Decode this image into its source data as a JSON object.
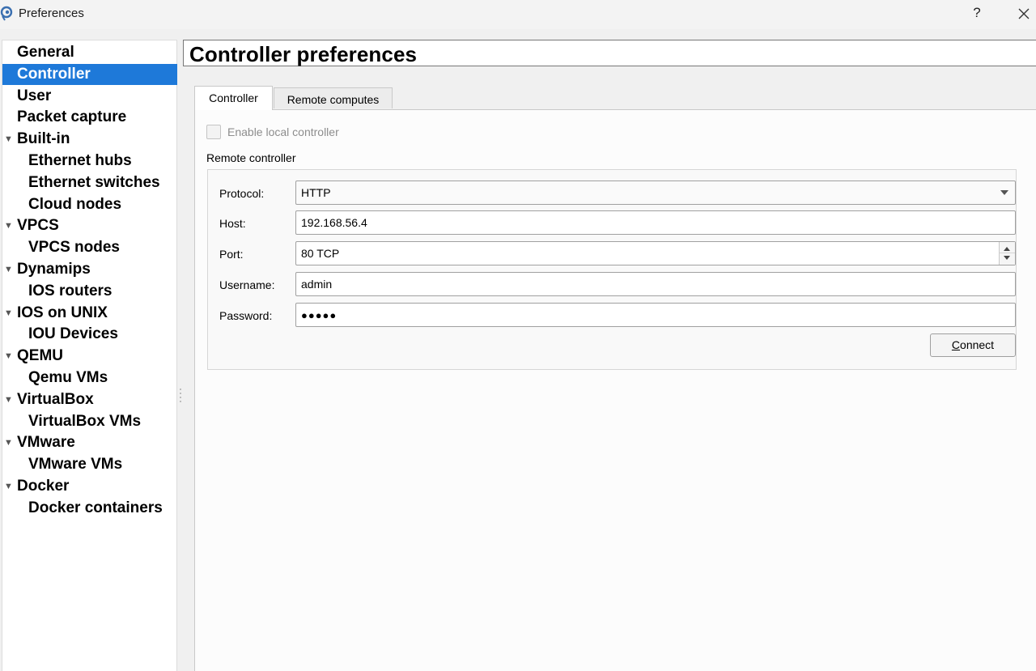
{
  "window": {
    "title": "Preferences",
    "help_label": "?",
    "icons": {
      "app": "gns3-app-icon",
      "close": "close-icon"
    }
  },
  "sidebar": {
    "selected_color": "#1e79d9",
    "items": [
      {
        "label": "General",
        "level": 0,
        "expandable": false,
        "selected": false
      },
      {
        "label": "Controller",
        "level": 0,
        "expandable": false,
        "selected": true
      },
      {
        "label": "User",
        "level": 0,
        "expandable": false,
        "selected": false
      },
      {
        "label": "Packet capture",
        "level": 0,
        "expandable": false,
        "selected": false
      },
      {
        "label": "Built-in",
        "level": 0,
        "expandable": true,
        "selected": false
      },
      {
        "label": "Ethernet hubs",
        "level": 1,
        "expandable": false,
        "selected": false
      },
      {
        "label": "Ethernet switches",
        "level": 1,
        "expandable": false,
        "selected": false
      },
      {
        "label": "Cloud nodes",
        "level": 1,
        "expandable": false,
        "selected": false
      },
      {
        "label": "VPCS",
        "level": 0,
        "expandable": true,
        "selected": false
      },
      {
        "label": "VPCS nodes",
        "level": 1,
        "expandable": false,
        "selected": false
      },
      {
        "label": "Dynamips",
        "level": 0,
        "expandable": true,
        "selected": false
      },
      {
        "label": "IOS routers",
        "level": 1,
        "expandable": false,
        "selected": false
      },
      {
        "label": "IOS on UNIX",
        "level": 0,
        "expandable": true,
        "selected": false
      },
      {
        "label": "IOU Devices",
        "level": 1,
        "expandable": false,
        "selected": false
      },
      {
        "label": "QEMU",
        "level": 0,
        "expandable": true,
        "selected": false
      },
      {
        "label": "Qemu VMs",
        "level": 1,
        "expandable": false,
        "selected": false
      },
      {
        "label": "VirtualBox",
        "level": 0,
        "expandable": true,
        "selected": false
      },
      {
        "label": "VirtualBox VMs",
        "level": 1,
        "expandable": false,
        "selected": false
      },
      {
        "label": "VMware",
        "level": 0,
        "expandable": true,
        "selected": false
      },
      {
        "label": "VMware VMs",
        "level": 1,
        "expandable": false,
        "selected": false
      },
      {
        "label": "Docker",
        "level": 0,
        "expandable": true,
        "selected": false
      },
      {
        "label": "Docker containers",
        "level": 1,
        "expandable": false,
        "selected": false
      }
    ]
  },
  "page": {
    "title": "Controller preferences",
    "tabs": [
      {
        "label": "Controller",
        "active": true
      },
      {
        "label": "Remote computes",
        "active": false
      }
    ],
    "local_controller": {
      "label": "Enable local controller",
      "checked": false,
      "enabled": false
    },
    "remote_controller": {
      "group_label": "Remote controller",
      "protocol": {
        "label": "Protocol:",
        "value": "HTTP"
      },
      "host": {
        "label": "Host:",
        "value": "192.168.56.4"
      },
      "port": {
        "label": "Port:",
        "value": "80 TCP"
      },
      "username": {
        "label": "Username:",
        "value": "admin"
      },
      "password": {
        "label": "Password:",
        "value": "●●●●●"
      },
      "connect": {
        "label_first": "C",
        "label_rest": "onnect"
      }
    }
  }
}
